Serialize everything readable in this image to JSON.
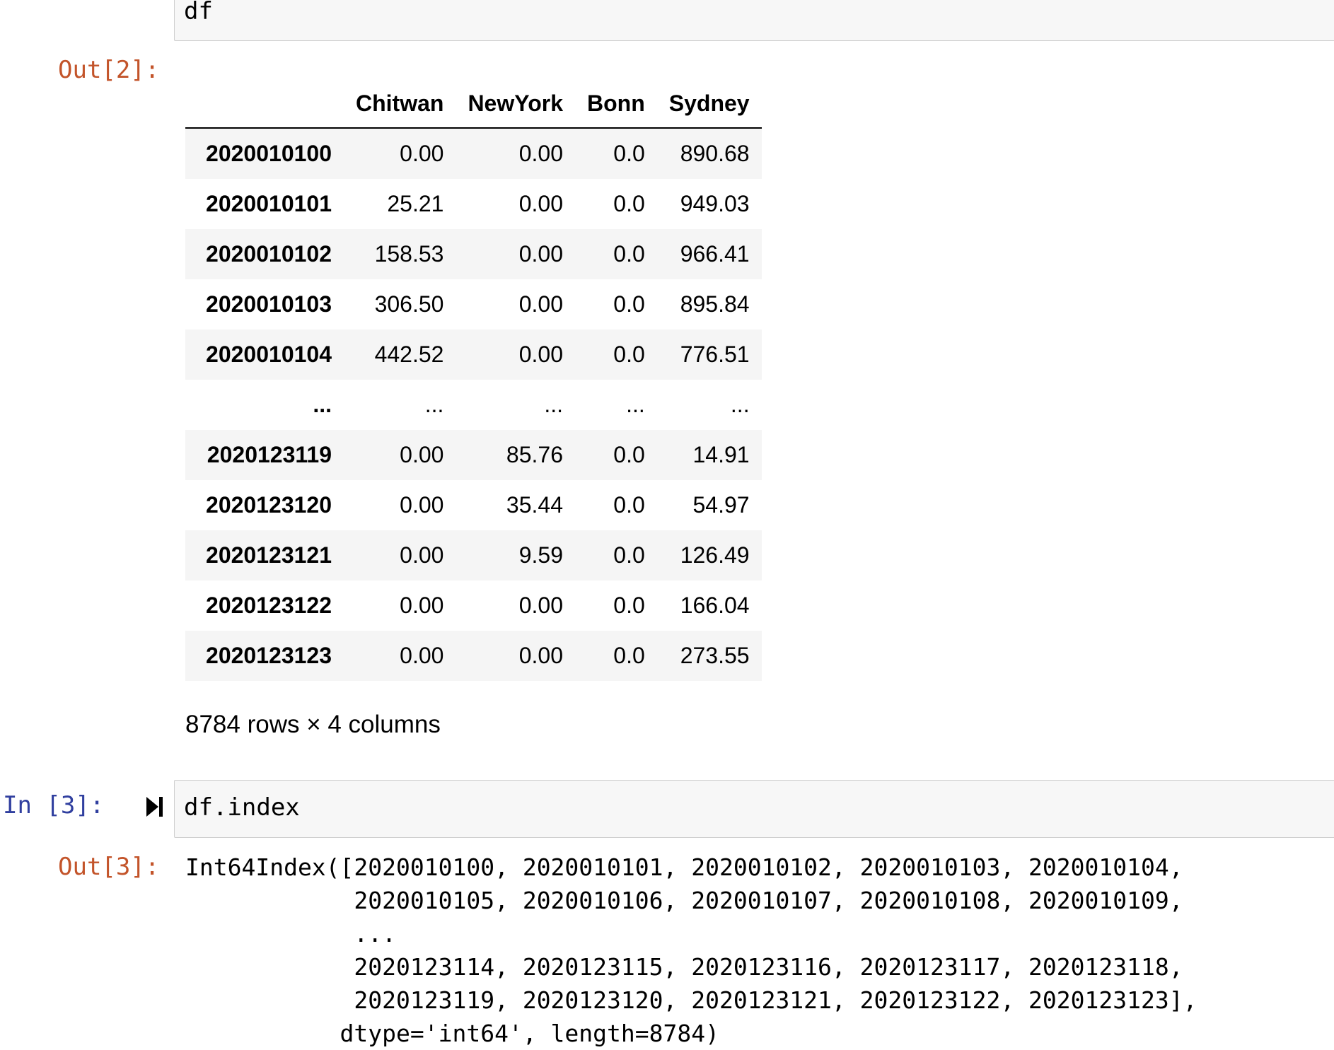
{
  "cell1": {
    "code": "df"
  },
  "cell2_output": {
    "prompt": "Out[2]:",
    "table": {
      "columns": [
        "",
        "Chitwan",
        "NewYork",
        "Bonn",
        "Sydney"
      ],
      "rows": [
        [
          "2020010100",
          "0.00",
          "0.00",
          "0.0",
          "890.68"
        ],
        [
          "2020010101",
          "25.21",
          "0.00",
          "0.0",
          "949.03"
        ],
        [
          "2020010102",
          "158.53",
          "0.00",
          "0.0",
          "966.41"
        ],
        [
          "2020010103",
          "306.50",
          "0.00",
          "0.0",
          "895.84"
        ],
        [
          "2020010104",
          "442.52",
          "0.00",
          "0.0",
          "776.51"
        ],
        [
          "...",
          "...",
          "...",
          "...",
          "..."
        ],
        [
          "2020123119",
          "0.00",
          "85.76",
          "0.0",
          "14.91"
        ],
        [
          "2020123120",
          "0.00",
          "35.44",
          "0.0",
          "54.97"
        ],
        [
          "2020123121",
          "0.00",
          "9.59",
          "0.0",
          "126.49"
        ],
        [
          "2020123122",
          "0.00",
          "0.00",
          "0.0",
          "166.04"
        ],
        [
          "2020123123",
          "0.00",
          "0.00",
          "0.0",
          "273.55"
        ]
      ]
    },
    "shape_text": "8784 rows × 4 columns"
  },
  "cell3": {
    "prompt": "In [3]:",
    "code": "df.index",
    "run_icon": "run-cell-icon"
  },
  "cell3_output": {
    "prompt": "Out[3]:",
    "lines": [
      "Int64Index([2020010100, 2020010101, 2020010102, 2020010103, 2020010104,",
      "            2020010105, 2020010106, 2020010107, 2020010108, 2020010109,",
      "            ...",
      "            2020123114, 2020123115, 2020123116, 2020123117, 2020123118,",
      "            2020123119, 2020123120, 2020123121, 2020123122, 2020123123],",
      "           dtype='int64', length=8784)"
    ]
  },
  "colors": {
    "out_prompt": "#c3542a",
    "in_prompt": "#303f9f",
    "cell_bg": "#f7f7f7",
    "cell_border": "#cfcfcf",
    "row_stripe": "#f5f5f5"
  }
}
